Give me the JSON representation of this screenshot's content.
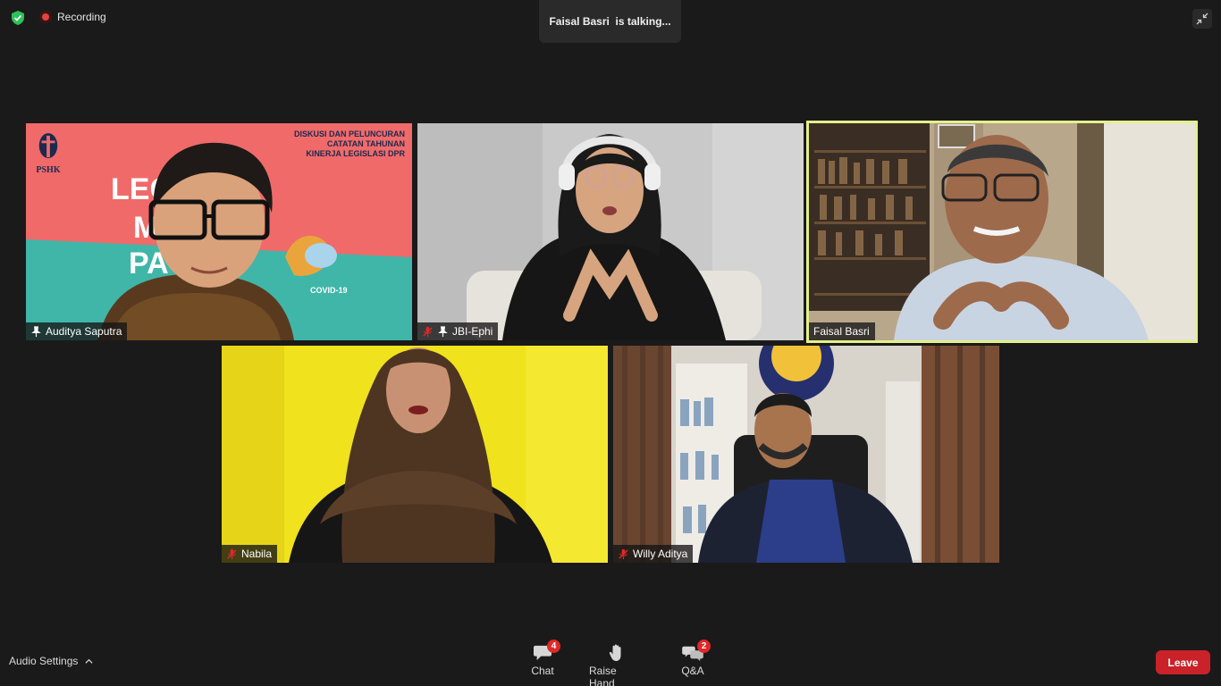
{
  "header": {
    "recording_label": "Recording",
    "talking_indicator": "Faisal Basri  is talking..."
  },
  "tiles": [
    {
      "name": "Auditya Saputra",
      "pinned": true,
      "muted": false,
      "active_speaker": false,
      "banner": {
        "logo": "PSHK",
        "title_line1": "DISKUSI DAN PELUNCURAN",
        "title_line2": "CATATAN TAHUNAN",
        "title_line3": "KINERJA LEGISLASI DPR",
        "footer": "COVID-19"
      }
    },
    {
      "name": "JBI-Ephi",
      "pinned": true,
      "muted": true,
      "active_speaker": false
    },
    {
      "name": "Faisal Basri",
      "pinned": false,
      "muted": false,
      "active_speaker": true
    },
    {
      "name": "Nabila",
      "pinned": false,
      "muted": true,
      "active_speaker": false
    },
    {
      "name": "Willy Aditya",
      "pinned": false,
      "muted": true,
      "active_speaker": false
    }
  ],
  "toolbar": {
    "audio_settings_label": "Audio Settings",
    "chat_label": "Chat",
    "chat_badge": "4",
    "raise_hand_label": "Raise Hand",
    "qa_label": "Q&A",
    "qa_badge": "2",
    "leave_label": "Leave"
  },
  "colors": {
    "background": "#1a1a1a",
    "active_speaker_border": "#e4f08a",
    "leave_button": "#c92228",
    "badge": "#e02828",
    "security_shield": "#2ec05a",
    "recording_dot": "#e0443e"
  }
}
